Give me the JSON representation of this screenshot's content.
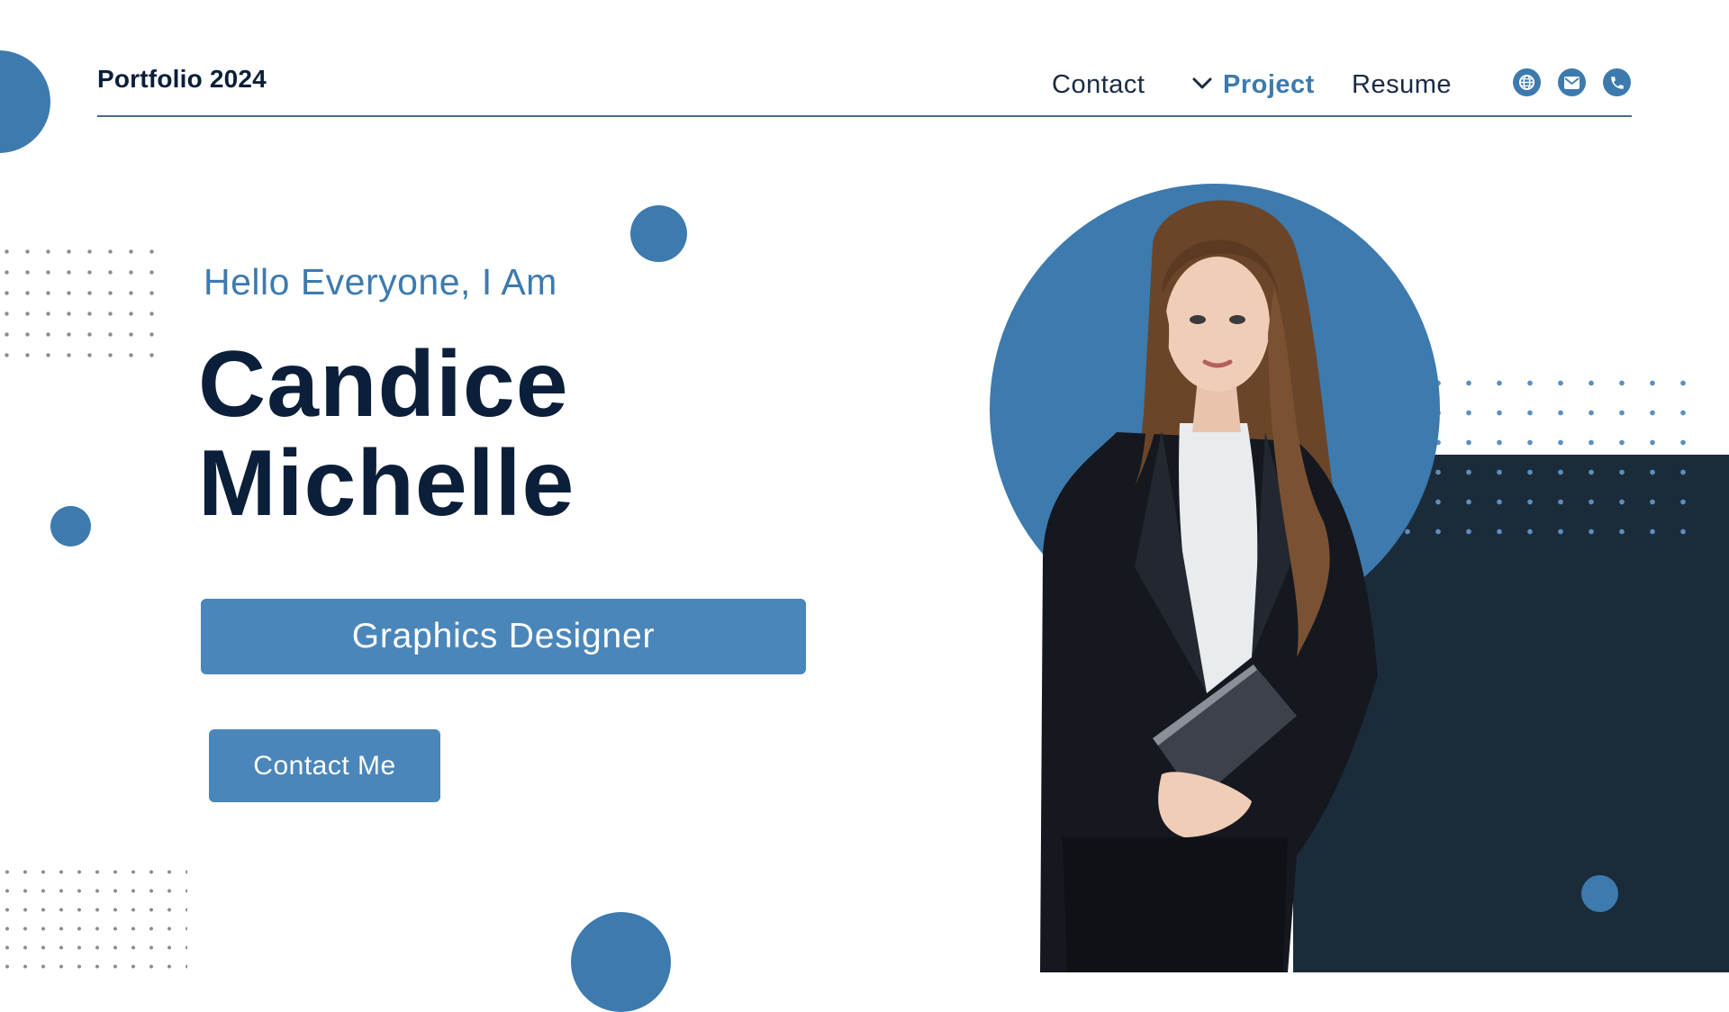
{
  "header": {
    "brand": "Portfolio 2024",
    "nav": [
      {
        "label": "Contact",
        "active": false
      },
      {
        "label": "Project",
        "active": true,
        "icon": "chevron-down-icon"
      },
      {
        "label": "Resume",
        "active": false
      }
    ],
    "social_icons": [
      "globe-icon",
      "mail-icon",
      "phone-icon"
    ]
  },
  "hero": {
    "greeting": "Hello Everyone, I Am",
    "name_line1": "Candice",
    "name_line2": "Michelle",
    "role": "Graphics Designer",
    "cta_label": "Contact Me"
  },
  "colors": {
    "accent": "#3d7aae",
    "button": "#4a86b9",
    "navy_text": "#0b1f3a",
    "dark_panel": "#1c2b3a",
    "background": "#ffffff"
  },
  "images": {
    "portrait": "woman in black blazer and white blouse holding a notebook"
  }
}
